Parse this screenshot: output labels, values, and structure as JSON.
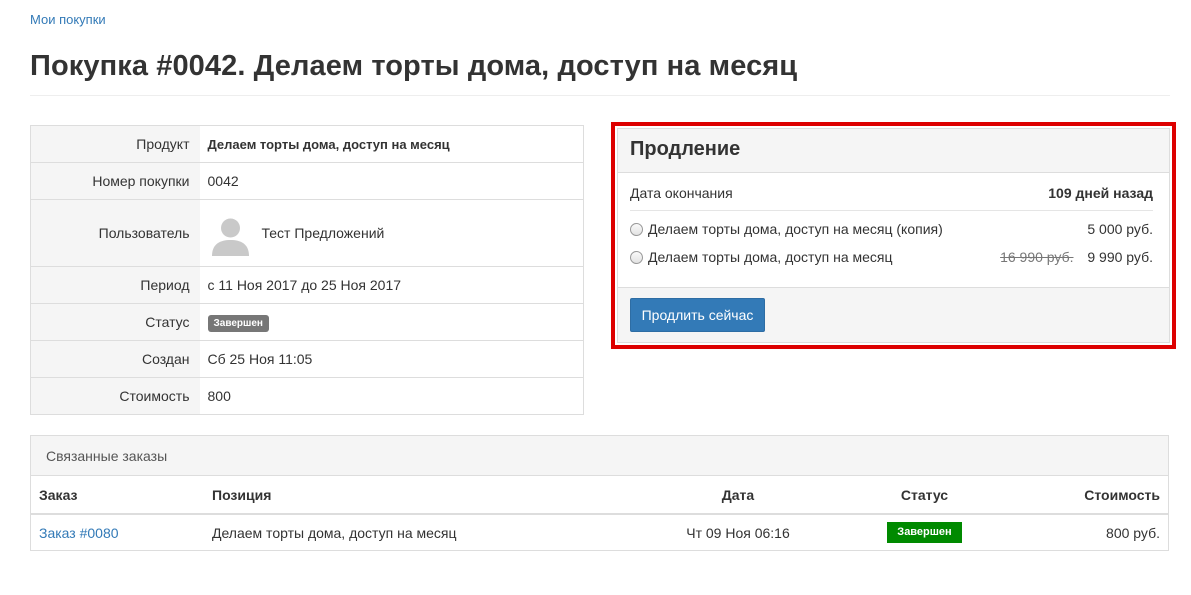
{
  "breadcrumb": {
    "label": "Мои покупки"
  },
  "page": {
    "title": "Покупка #0042. Делаем торты дома, доступ на месяц"
  },
  "details": {
    "product_label": "Продукт",
    "product_value": "Делаем торты дома, доступ на месяц",
    "number_label": "Номер покупки",
    "number_value": "0042",
    "user_label": "Пользователь",
    "user_name": "Тест Предложений",
    "period_label": "Период",
    "period_value": "с 11 Ноя 2017 до 25 Ноя 2017",
    "status_label": "Статус",
    "status_value": "Завершен",
    "created_label": "Создан",
    "created_value": "Сб 25 Ноя 11:05",
    "cost_label": "Стоимость",
    "cost_value": "800"
  },
  "renewal": {
    "title": "Продление",
    "end_label": "Дата окончания",
    "end_value": "109 дней назад",
    "options": [
      {
        "label": "Делаем торты дома, доступ на месяц (копия)",
        "old_price": "",
        "price": "5 000 руб."
      },
      {
        "label": "Делаем торты дома, доступ на месяц",
        "old_price": "16 990 руб.",
        "price": "9 990 руб."
      }
    ],
    "button_label": "Продлить сейчас"
  },
  "orders": {
    "title": "Связанные заказы",
    "columns": [
      "Заказ",
      "Позиция",
      "Дата",
      "Статус",
      "Стоимость"
    ],
    "rows": [
      {
        "order": "Заказ #0080",
        "item": "Делаем торты дома, доступ на месяц",
        "date": "Чт 09 Ноя 06:16",
        "status": "Завершен",
        "cost": "800 руб."
      }
    ]
  },
  "colors": {
    "accent": "#337ab7",
    "highlight_outline": "#dd0000",
    "status_gray": "#777777",
    "status_green": "#008a00"
  },
  "icons": {
    "avatar": "user-silhouette-icon",
    "option_radio": "radio-icon"
  }
}
